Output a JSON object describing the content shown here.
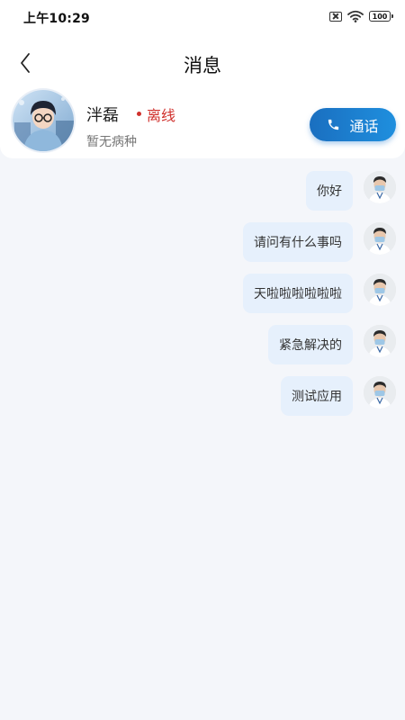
{
  "status_bar": {
    "time": "上午10:29",
    "battery": "100",
    "icons": [
      "sim-off-icon",
      "wifi-icon",
      "battery-icon"
    ]
  },
  "header": {
    "title": "消息",
    "back_icon": "chevron-left-icon"
  },
  "contact": {
    "name": "泮磊",
    "status": "离线",
    "disease": "暂无病种",
    "call_label": "通话",
    "call_icon": "phone-icon"
  },
  "messages": [
    {
      "text": "你好"
    },
    {
      "text": "请问有什么事吗"
    },
    {
      "text": "天啦啦啦啦啦啦"
    },
    {
      "text": "紧急解决的"
    },
    {
      "text": "测试应用"
    }
  ],
  "colors": {
    "accent": "#1f7fd0",
    "offline": "#d0312d",
    "bubble": "#e6f0fc",
    "background": "#f4f6fa"
  }
}
